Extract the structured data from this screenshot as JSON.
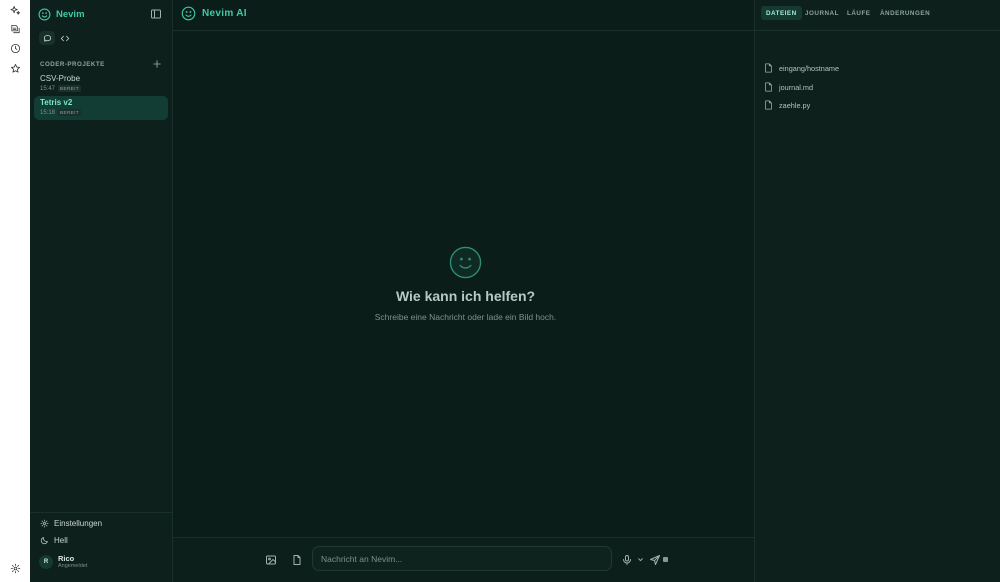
{
  "rail": {
    "items": [
      {
        "icon": "sparkles-icon"
      },
      {
        "icon": "file-stack-icon"
      },
      {
        "icon": "clock-icon"
      },
      {
        "icon": "star-icon"
      }
    ],
    "settings_icon": "gear-icon"
  },
  "sidebar": {
    "brand": "Nevim",
    "section_title": "CODER-PROJEKTE",
    "projects": [
      {
        "name": "CSV-Probe",
        "time": "15:47",
        "status": "BEREIT"
      },
      {
        "name": "Tetris v2",
        "time": "15:18",
        "status": "BEREIT"
      }
    ],
    "settings_label": "Einstellungen",
    "theme_label": "Hell",
    "user": {
      "initial": "R",
      "name": "Rico",
      "status": "Angemeldet"
    }
  },
  "main": {
    "title": "Nevim AI",
    "empty_title": "Wie kann ich helfen?",
    "empty_subtitle": "Schreibe eine Nachricht oder lade ein Bild hoch.",
    "input_placeholder": "Nachricht an Nevim..."
  },
  "panel": {
    "tabs": [
      "DATEIEN",
      "JOURNAL",
      "LÄUFE",
      "ÄNDERUNGEN"
    ],
    "files": [
      "eingang/hostname",
      "journal.md",
      "zaehle.py"
    ]
  },
  "colors": {
    "accent": "#3fc9a7",
    "background": "#0b1d19",
    "active_project": "#123d34"
  }
}
